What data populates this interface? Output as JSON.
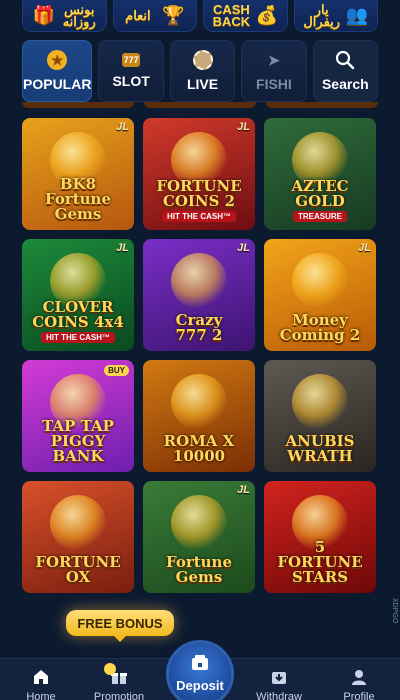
{
  "promo": [
    {
      "text": "بونس\nروزانه",
      "icon": "gift-icon"
    },
    {
      "text": "انعام",
      "icon": "trophy-icon"
    },
    {
      "text": "CASH\nBACK",
      "icon": "coin-icon"
    },
    {
      "text": "یار\nریفرال",
      "icon": "users-icon"
    }
  ],
  "tabs": [
    {
      "label": "POPULAR",
      "icon": "medal-icon"
    },
    {
      "label": "SLOT",
      "icon": "slot-icon"
    },
    {
      "label": "LIVE",
      "icon": "chip-icon"
    },
    {
      "label": "FISHI",
      "icon": "fish-icon"
    },
    {
      "label": "Search",
      "icon": "search-icon"
    }
  ],
  "games": [
    {
      "title": "BK8\nFortune Gems",
      "provider": "JL",
      "colors": [
        "#e8a21b",
        "#b5560f"
      ]
    },
    {
      "title": "FORTUNE\nCOINS 2",
      "provider": "JL",
      "sub": "HIT THE CASH™",
      "colors": [
        "#d13a2a",
        "#6e0d12"
      ]
    },
    {
      "title": "AZTEC\nGOLD",
      "provider": "",
      "sub": "TREASURE",
      "colors": [
        "#2f6b3a",
        "#173b22"
      ]
    },
    {
      "title": "CLOVER\nCOINS 4x4",
      "provider": "JL",
      "sub": "HIT THE CASH™",
      "colors": [
        "#1d8a3a",
        "#0a4a20"
      ]
    },
    {
      "title": "Crazy\n777 2",
      "provider": "JL",
      "colors": [
        "#7a2ec8",
        "#3d1470"
      ]
    },
    {
      "title": "Money Coming 2",
      "provider": "JL",
      "colors": [
        "#f3a51a",
        "#b85a06"
      ]
    },
    {
      "title": "TAP TAP\nPIGGY BANK",
      "provider": "",
      "buy": "BUY",
      "colors": [
        "#d43bd4",
        "#6d1fae"
      ]
    },
    {
      "title": "ROMA X\n10000",
      "provider": "",
      "colors": [
        "#d27a12",
        "#7a2e05"
      ]
    },
    {
      "title": "ANUBIS\nWRATH",
      "provider": "",
      "colors": [
        "#5e5a52",
        "#2a2520"
      ]
    },
    {
      "title": "FORTUNE\nOX",
      "provider": "",
      "colors": [
        "#d8502b",
        "#7a1e0e"
      ]
    },
    {
      "title": "Fortune Gems",
      "provider": "JL",
      "colors": [
        "#3a7b38",
        "#1c4a1c"
      ]
    },
    {
      "title": "5\nFORTUNE\nSTARS",
      "provider": "",
      "colors": [
        "#d2231e",
        "#6e0808"
      ]
    }
  ],
  "free_bonus": "FREE BONUS",
  "bottom_nav": [
    {
      "label": "Home",
      "icon": "home-icon"
    },
    {
      "label": "Promotion",
      "icon": "gift-icon"
    },
    {
      "label": "Deposit",
      "icon": "wallet-icon"
    },
    {
      "label": "Withdraw",
      "icon": "withdraw-icon"
    },
    {
      "label": "Profile",
      "icon": "profile-icon"
    }
  ],
  "side_mark": "XDPGO"
}
